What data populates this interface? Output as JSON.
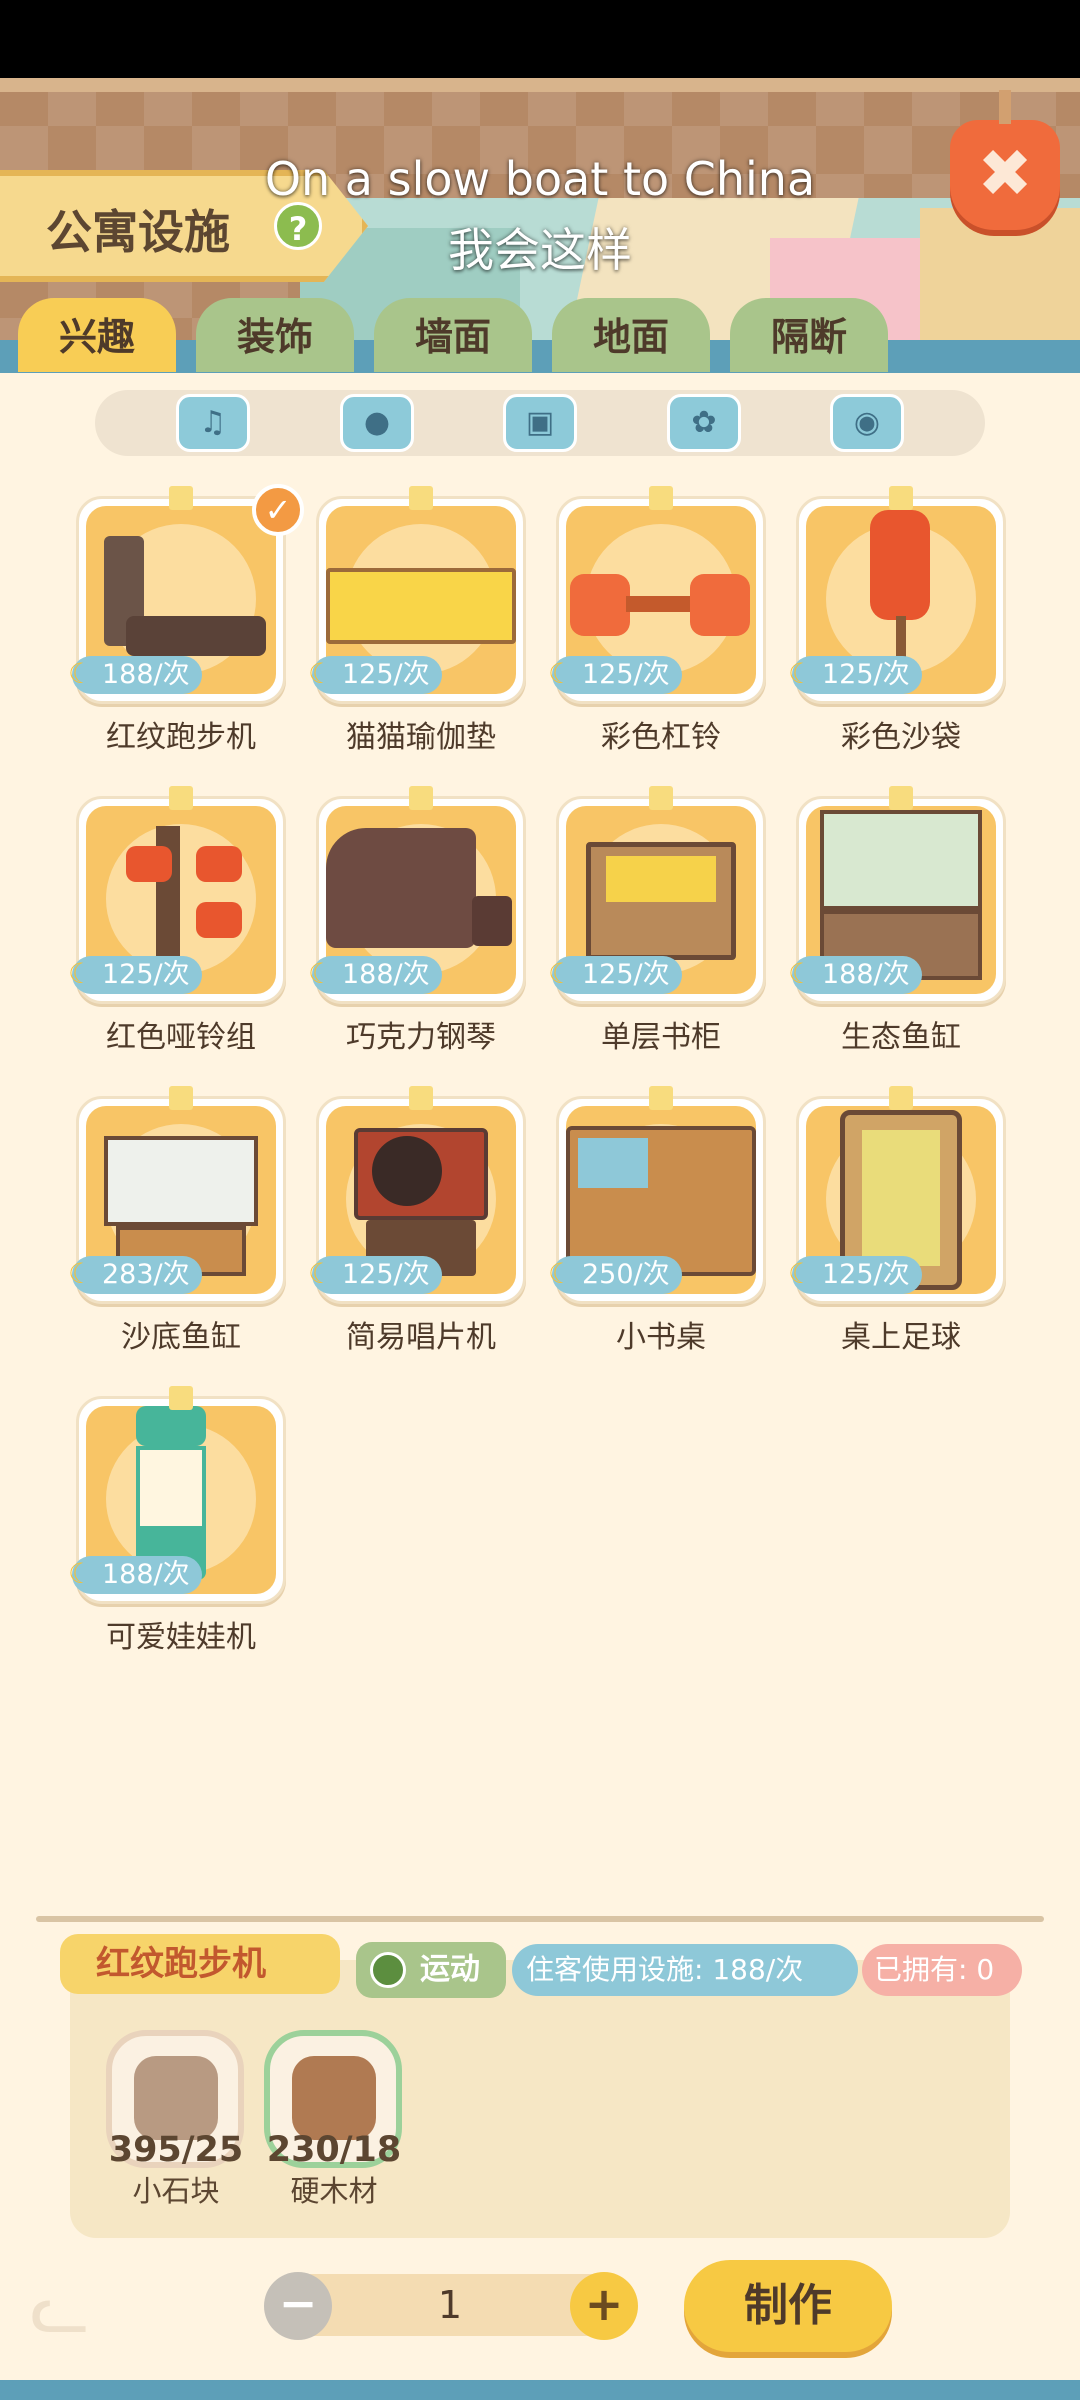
{
  "header": {
    "title": "公寓设施",
    "help_icon": "?",
    "close_icon": "✖",
    "lyric_line1": "On a slow boat to China",
    "lyric_line2": "我会这样"
  },
  "tabs": [
    {
      "label": "兴趣",
      "active": true
    },
    {
      "label": "装饰",
      "active": false
    },
    {
      "label": "墙面",
      "active": false
    },
    {
      "label": "地面",
      "active": false
    },
    {
      "label": "隔断",
      "active": false
    }
  ],
  "filters": [
    {
      "icon": "music-icon",
      "glyph": "♫"
    },
    {
      "icon": "ball-icon",
      "glyph": "●"
    },
    {
      "icon": "disk-icon",
      "glyph": "▣"
    },
    {
      "icon": "flower-icon",
      "glyph": "✿"
    },
    {
      "icon": "gamepad-icon",
      "glyph": "◉"
    }
  ],
  "items": [
    {
      "name": "红纹跑步机",
      "price": "188/次",
      "selected": true
    },
    {
      "name": "猫猫瑜伽垫",
      "price": "125/次"
    },
    {
      "name": "彩色杠铃",
      "price": "125/次"
    },
    {
      "name": "彩色沙袋",
      "price": "125/次"
    },
    {
      "name": "红色哑铃组",
      "price": "125/次"
    },
    {
      "name": "巧克力钢琴",
      "price": "188/次"
    },
    {
      "name": "单层书柜",
      "price": "125/次"
    },
    {
      "name": "生态鱼缸",
      "price": "188/次"
    },
    {
      "name": "沙底鱼缸",
      "price": "283/次"
    },
    {
      "name": "简易唱片机",
      "price": "125/次"
    },
    {
      "name": "小书桌",
      "price": "250/次"
    },
    {
      "name": "桌上足球",
      "price": "125/次"
    },
    {
      "name": "可爱娃娃机",
      "price": "188/次"
    }
  ],
  "detail": {
    "name": "红纹跑步机",
    "category": "运动",
    "usage": "住客使用设施: 188/次",
    "owned": "已拥有: 0",
    "materials": [
      {
        "count": "395/25",
        "name": "小石块",
        "icon": "stone-icon"
      },
      {
        "count": "230/18",
        "name": "硬木材",
        "icon": "wood-icon"
      }
    ],
    "quantity": "1",
    "minus": "−",
    "plus": "+",
    "make_label": "制作"
  },
  "colors": {
    "background": "#fff4e1",
    "accent_yellow": "#f7c943",
    "tab_green": "#a9c58b",
    "price_blue": "#8ec8d8"
  }
}
